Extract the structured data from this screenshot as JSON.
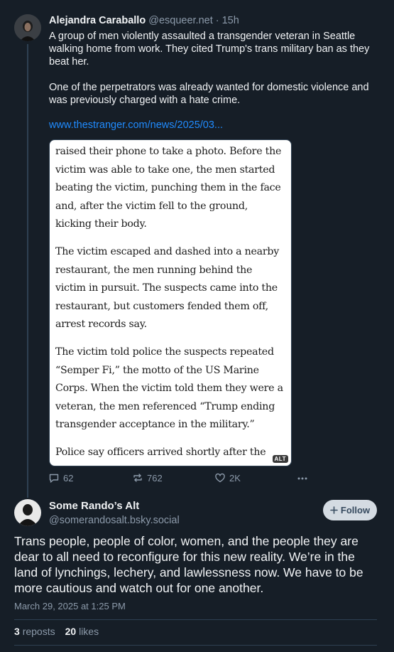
{
  "post1": {
    "author_name": "Alejandra Caraballo",
    "author_handle": "@esqueer.net",
    "time_ago": "· 15h",
    "paragraphs": [
      "A group of men violently assaulted a transgender veteran in Seattle walking home from work. They cited Trump's trans military ban as they beat her.",
      "One of the perpetrators was already wanted for domestic violence and was previously charged with a hate crime."
    ],
    "link_text": "www.thestranger.com/news/2025/03...",
    "embed_paragraphs": [
      "raised their phone to take a photo. Before the victim was able to take one, the men started beating the victim, punching them in the face and, after the victim fell to the ground, kicking their body.",
      "The victim escaped and dashed into a nearby restaurant, the men running behind the victim in pursuit. The suspects came into the restaurant, but customers fended them off, arrest records say.",
      "The victim told police the suspects repeated “Semper Fi,” the motto of the US Marine Corps. When the victim told them they were a veteran, the men referenced “Trump ending transgender acceptance in the military.”",
      "Police say officers arrived shortly after the"
    ],
    "alt_badge": "ALT",
    "reply_count": "62",
    "repost_count": "762",
    "like_count": "2K"
  },
  "post2": {
    "author_name": "Some Rando’s Alt",
    "author_handle": "@somerandosalt.bsky.social",
    "follow_label": "Follow",
    "text": "Trans people, people of color, women, and the people they are dear to all need to reconfigure for this new reality. We’re in the land of lynchings, lechery, and lawlessness now. We have to be more cautious and watch out for one another.",
    "timestamp": "March 29, 2025 at 1:25 PM",
    "reposts_count": "3",
    "reposts_label": "reposts",
    "likes_count": "20",
    "likes_label": "likes"
  },
  "icons": {
    "reply": "reply-icon",
    "repost": "repost-icon",
    "like": "heart-icon",
    "more": "more-icon",
    "follow": "plus-icon"
  },
  "colors": {
    "background": "#161e27",
    "link": "#208bfe",
    "muted": "#8c9aaa",
    "follow_button": "#d4dbe2"
  }
}
